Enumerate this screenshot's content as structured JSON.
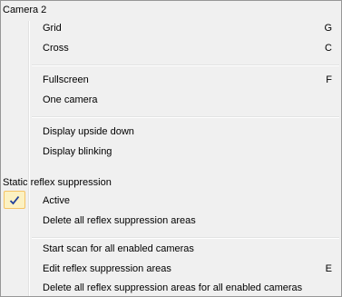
{
  "menu": {
    "section1_header": "Camera 2",
    "grid": {
      "label": "Grid",
      "shortcut": "G"
    },
    "cross": {
      "label": "Cross",
      "shortcut": "C"
    },
    "fullscreen": {
      "label": "Fullscreen",
      "shortcut": "F"
    },
    "one_camera": {
      "label": "One camera"
    },
    "display_upside_down": {
      "label": "Display upside down"
    },
    "display_blinking": {
      "label": "Display blinking"
    },
    "section2_header": "Static reflex suppression",
    "active": {
      "label": "Active",
      "checked": true
    },
    "delete_all_areas": {
      "label": "Delete all reflex suppression areas"
    },
    "start_scan": {
      "label": "Start scan for all enabled cameras"
    },
    "edit_areas": {
      "label": "Edit reflex suppression areas",
      "shortcut": "E"
    },
    "delete_all_areas_enabled": {
      "label": "Delete all reflex suppression areas for all enabled cameras"
    }
  },
  "colors": {
    "menu_background": "#f0f0f0",
    "check_highlight": "#fcf1c2",
    "check_mark": "#1f3e9a"
  }
}
